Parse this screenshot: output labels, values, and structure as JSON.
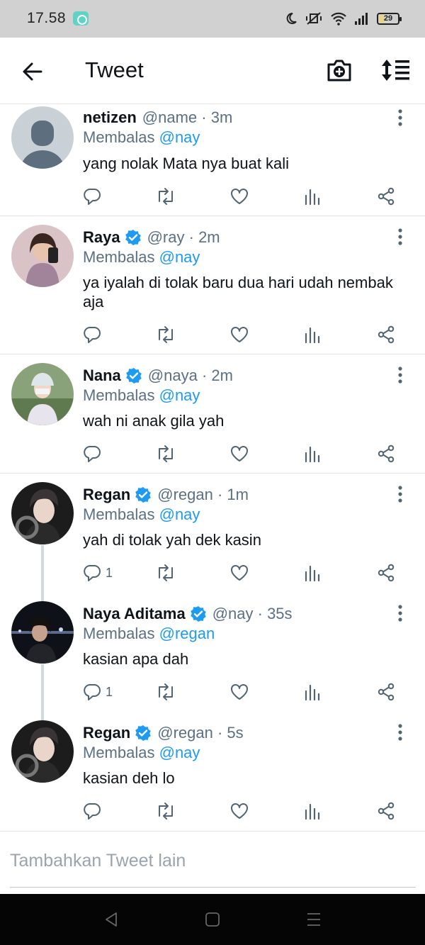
{
  "status_bar": {
    "time": "17.58",
    "battery": "29",
    "battery_level": 0.29
  },
  "header": {
    "title": "Tweet"
  },
  "tweets": [
    {
      "name": "netizen",
      "verified": false,
      "handle": "@name",
      "time": "3m",
      "reply_prefix": "Membalas",
      "reply_to": "@nay",
      "text": "yang nolak Mata nya buat kali",
      "reply_count": ""
    },
    {
      "name": "Raya",
      "verified": true,
      "handle": "@ray",
      "time": "2m",
      "reply_prefix": "Membalas",
      "reply_to": "@nay",
      "text": "ya iyalah di tolak baru dua hari udah nembak aja",
      "reply_count": ""
    },
    {
      "name": "Nana",
      "verified": true,
      "handle": "@naya",
      "time": "2m",
      "reply_prefix": "Membalas",
      "reply_to": "@nay",
      "text": "wah ni anak gila yah",
      "reply_count": ""
    },
    {
      "name": "Regan",
      "verified": true,
      "handle": "@regan",
      "time": "1m",
      "reply_prefix": "Membalas",
      "reply_to": "@nay",
      "text": "yah di tolak yah dek kasin",
      "reply_count": "1"
    },
    {
      "name": "Naya Aditama",
      "verified": true,
      "handle": "@nay",
      "time": "35s",
      "reply_prefix": "Membalas",
      "reply_to": "@regan",
      "text": "kasian apa dah",
      "reply_count": "1"
    },
    {
      "name": "Regan",
      "verified": true,
      "handle": "@regan",
      "time": "5s",
      "reply_prefix": "Membalas",
      "reply_to": "@nay",
      "text": "kasian deh lo",
      "reply_count": ""
    }
  ],
  "compose": {
    "placeholder": "Tambahkan Tweet lain"
  },
  "colors": {
    "accent": "#1d9bf0",
    "secondary_text": "#5b7083",
    "status_bar": "#d1d1d1",
    "nav_bar": "#050505"
  },
  "icons": [
    "arrow-left-icon",
    "camera-plus-icon",
    "sort-icon",
    "more-vertical-icon",
    "reply-icon",
    "retweet-icon",
    "like-icon",
    "analytics-icon",
    "share-icon",
    "verified-badge-icon"
  ]
}
